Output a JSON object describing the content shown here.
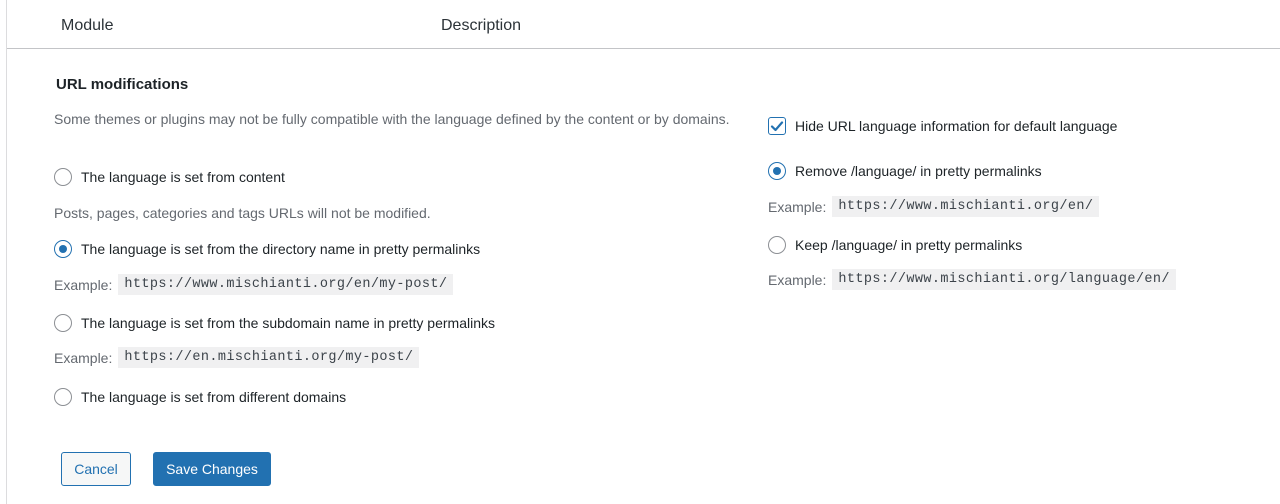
{
  "table_header": {
    "module": "Module",
    "description": "Description"
  },
  "section": {
    "title": "URL modifications",
    "compat_note": "Some themes or plugins may not be fully compatible with the language defined by the content or by domains."
  },
  "left_options": [
    {
      "label": "The language is set from content",
      "checked": false
    },
    {
      "label": "The language is set from the directory name in pretty permalinks",
      "checked": true
    },
    {
      "label": "The language is set from the subdomain name in pretty permalinks",
      "checked": false
    },
    {
      "label": "The language is set from different domains",
      "checked": false
    }
  ],
  "content_note": "Posts, pages, categories and tags URLs will not be modified.",
  "examples_left": {
    "label": "Example:",
    "directory": "https://www.mischianti.org/en/my-post/",
    "subdomain": "https://en.mischianti.org/my-post/"
  },
  "right": {
    "hide_default_label": "Hide URL language information for default language",
    "hide_default_checked": true,
    "remove_label": "Remove /language/ in pretty permalinks",
    "remove_checked": true,
    "remove_example": "https://www.mischianti.org/en/",
    "keep_label": "Keep /language/ in pretty permalinks",
    "keep_checked": false,
    "keep_example": "https://www.mischianti.org/language/en/",
    "example_label": "Example:"
  },
  "buttons": {
    "cancel": "Cancel",
    "save": "Save Changes"
  },
  "colors": {
    "accent": "#2271b1",
    "muted_text": "#646970"
  }
}
